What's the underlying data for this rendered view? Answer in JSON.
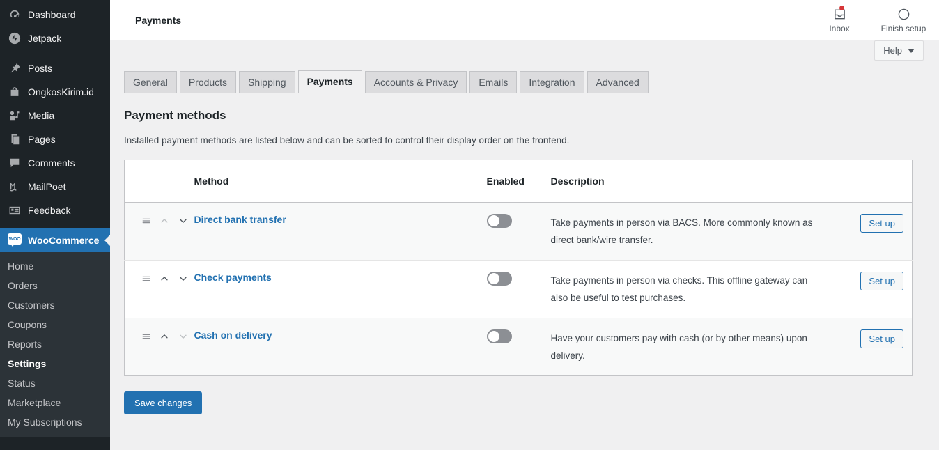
{
  "sidebar": {
    "items": [
      {
        "label": "Dashboard",
        "icon": "dashboard-icon"
      },
      {
        "label": "Jetpack",
        "icon": "jetpack-icon"
      },
      {
        "label": "Posts",
        "icon": "pin-icon"
      },
      {
        "label": "OngkosKirim.id",
        "icon": "bag-icon"
      },
      {
        "label": "Media",
        "icon": "media-icon"
      },
      {
        "label": "Pages",
        "icon": "pages-icon"
      },
      {
        "label": "Comments",
        "icon": "comment-icon"
      },
      {
        "label": "MailPoet",
        "icon": "mailpoet-icon"
      },
      {
        "label": "Feedback",
        "icon": "feedback-icon"
      }
    ],
    "woocommerce": {
      "label": "WooCommerce",
      "icon": "woocommerce-logo",
      "logo_text": "WOO"
    },
    "submenu": [
      {
        "label": "Home",
        "current": false
      },
      {
        "label": "Orders",
        "current": false
      },
      {
        "label": "Customers",
        "current": false
      },
      {
        "label": "Coupons",
        "current": false
      },
      {
        "label": "Reports",
        "current": false
      },
      {
        "label": "Settings",
        "current": true
      },
      {
        "label": "Status",
        "current": false
      },
      {
        "label": "Marketplace",
        "current": false
      },
      {
        "label": "My Subscriptions",
        "current": false
      }
    ]
  },
  "topbar": {
    "title": "Payments",
    "inbox": {
      "label": "Inbox",
      "icon": "inbox-icon",
      "has_notification": true
    },
    "finish_setup": {
      "label": "Finish setup",
      "icon": "progress-circle-icon"
    },
    "help": {
      "label": "Help",
      "icon": "chevron-down-icon"
    }
  },
  "tabs": [
    {
      "label": "General",
      "active": false
    },
    {
      "label": "Products",
      "active": false
    },
    {
      "label": "Shipping",
      "active": false
    },
    {
      "label": "Payments",
      "active": true
    },
    {
      "label": "Accounts & Privacy",
      "active": false
    },
    {
      "label": "Emails",
      "active": false
    },
    {
      "label": "Integration",
      "active": false
    },
    {
      "label": "Advanced",
      "active": false
    }
  ],
  "page": {
    "section_title": "Payment methods",
    "section_desc": "Installed payment methods are listed below and can be sorted to control their display order on the frontend.",
    "save_label": "Save changes"
  },
  "table": {
    "columns": {
      "sort": "",
      "method": "Method",
      "enabled": "Enabled",
      "description": "Description",
      "action": ""
    },
    "rows": [
      {
        "method": "Direct bank transfer",
        "enabled": false,
        "description": "Take payments in person via BACS. More commonly known as direct bank/wire transfer.",
        "action_label": "Set up",
        "move_up_disabled": true,
        "move_down_disabled": false
      },
      {
        "method": "Check payments",
        "enabled": false,
        "description": "Take payments in person via checks. This offline gateway can also be useful to test purchases.",
        "action_label": "Set up",
        "move_up_disabled": false,
        "move_down_disabled": false
      },
      {
        "method": "Cash on delivery",
        "enabled": false,
        "description": "Have your customers pay with cash (or by other means) upon delivery.",
        "action_label": "Set up",
        "move_up_disabled": false,
        "move_down_disabled": true
      }
    ]
  },
  "colors": {
    "accent": "#2271b1",
    "sidebar_bg": "#1d2327",
    "submenu_bg": "#2c3338",
    "page_bg": "#f0f0f1",
    "notification": "#d63638"
  }
}
